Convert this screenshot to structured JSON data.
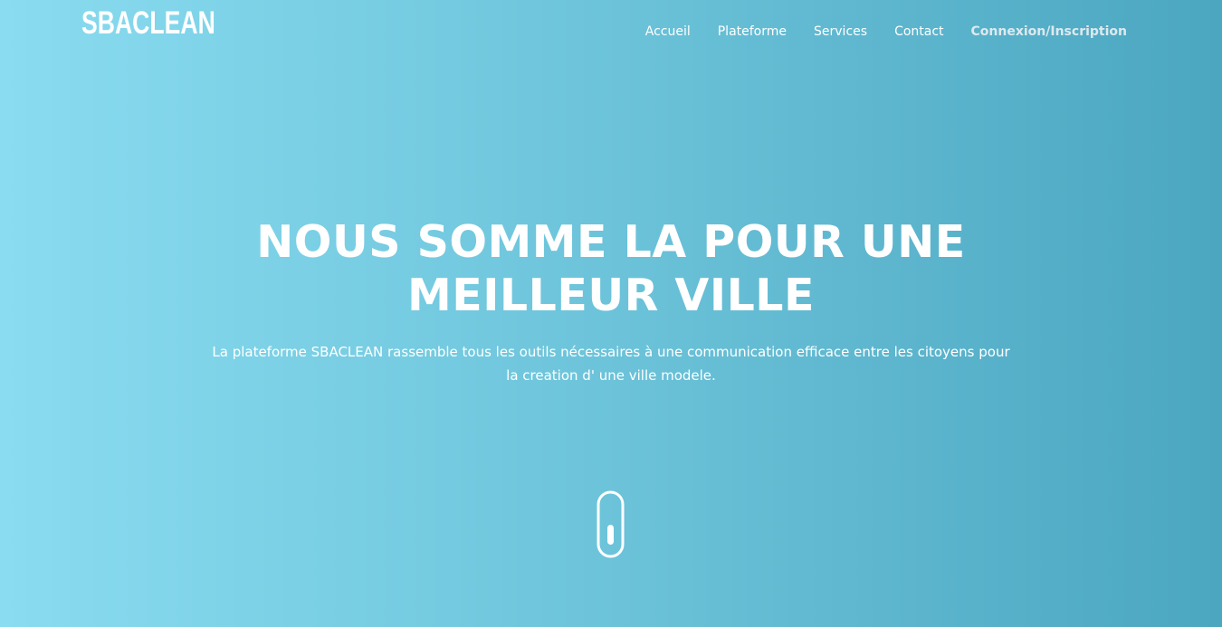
{
  "brand": {
    "logo_text": "SBACLEAN"
  },
  "nav": {
    "items": [
      {
        "label": "Accueil"
      },
      {
        "label": "Plateforme"
      },
      {
        "label": "Services"
      },
      {
        "label": "Contact"
      },
      {
        "label": "Connexion/Inscription"
      }
    ]
  },
  "hero": {
    "headline_line1": "NOUS SOMME LA POUR UNE",
    "headline_line2": "MEILLEUR VILLE",
    "subtitle_line1": "La plateforme SBACLEAN rassemble tous les outils nécessaires à une communication efficace entre les citoyens pour",
    "subtitle_line2": "la creation d' une ville modele."
  },
  "scroll": {
    "icon": "mouse-scroll-icon"
  },
  "colors": {
    "gradient_start": "#8adcf0",
    "gradient_end": "#4ba6c0",
    "text": "#ffffff",
    "login_link": "#dde9ee"
  }
}
